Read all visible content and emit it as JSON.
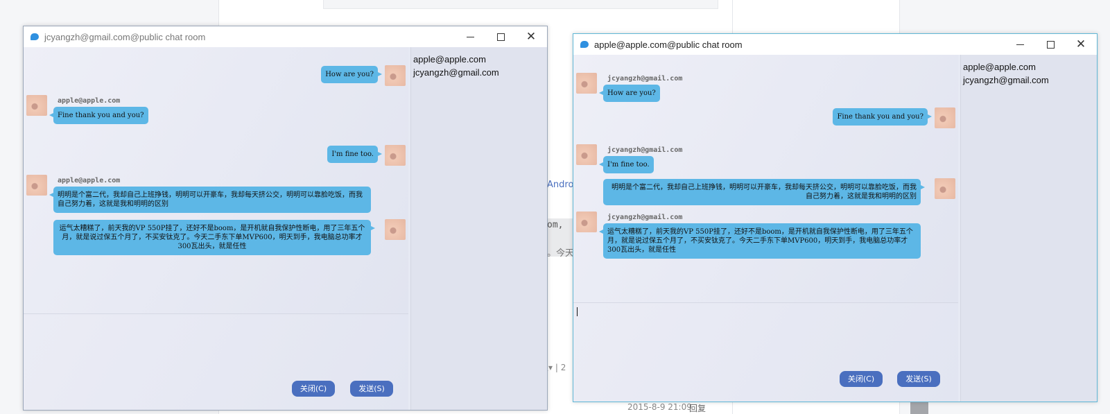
{
  "background": {
    "text_andro": "Andro",
    "text_om": "om,",
    "text_jin": "。今天",
    "text_reply_meta": "很▾ | 2",
    "timestamp": "2015-8-9 21:09",
    "reply_label": "回复"
  },
  "window1": {
    "title": "jcyangzh@gmail.com@public chat room",
    "members": [
      "apple@apple.com",
      "jcyangzh@gmail.com"
    ],
    "messages": [
      {
        "side": "right",
        "text": "How are you?"
      },
      {
        "side": "left",
        "sender": "apple@apple.com",
        "text": "Fine thank you and you?"
      },
      {
        "side": "right",
        "text": "I'm fine too."
      },
      {
        "side": "left",
        "sender": "apple@apple.com",
        "text": "明明是个富二代，我却自己上班挣钱，明明可以开豪车，我却每天挤公交，明明可以靠脸吃饭，而我自己努力着，这就是我和明明的区别"
      },
      {
        "side": "right",
        "text": "运气太糟糕了，前天我的VP 550P挂了，还好不是boom，是开机就自我保护性断电，用了三年五个月，就是说过保五个月了，不买安钛克了。今天二手东下单MVP600，明天到手，我电脑总功率才300瓦出头，就是任性"
      }
    ],
    "close_button": "关闭(C)",
    "send_button": "发送(S)"
  },
  "window2": {
    "title": "apple@apple.com@public chat room",
    "members": [
      "apple@apple.com",
      "jcyangzh@gmail.com"
    ],
    "messages": [
      {
        "side": "left",
        "sender": "jcyangzh@gmail.com",
        "text": "How are you?"
      },
      {
        "side": "right",
        "text": "Fine thank you and you?"
      },
      {
        "side": "left",
        "sender": "jcyangzh@gmail.com",
        "text": "I'm fine too."
      },
      {
        "side": "right",
        "text": "明明是个富二代，我却自己上班挣钱，明明可以开豪车，我却每天挤公交，明明可以靠脸吃饭，而我自己努力着，这就是我和明明的区别"
      },
      {
        "side": "left",
        "sender": "jcyangzh@gmail.com",
        "text": "运气太糟糕了，前天我的VP 550P挂了，还好不是boom，是开机就自我保护性断电，用了三年五个月，就是说过保五个月了，不买安钛克了。今天二手东下单MVP600，明天到手，我电脑总功率才300瓦出头，就是任性"
      }
    ],
    "close_button": "关闭(C)",
    "send_button": "发送(S)",
    "input_value": ""
  },
  "icons": {
    "title_icon": "chat-bubble-icon",
    "minimize": "minimize-icon",
    "maximize": "maximize-icon",
    "close": "close-icon"
  }
}
